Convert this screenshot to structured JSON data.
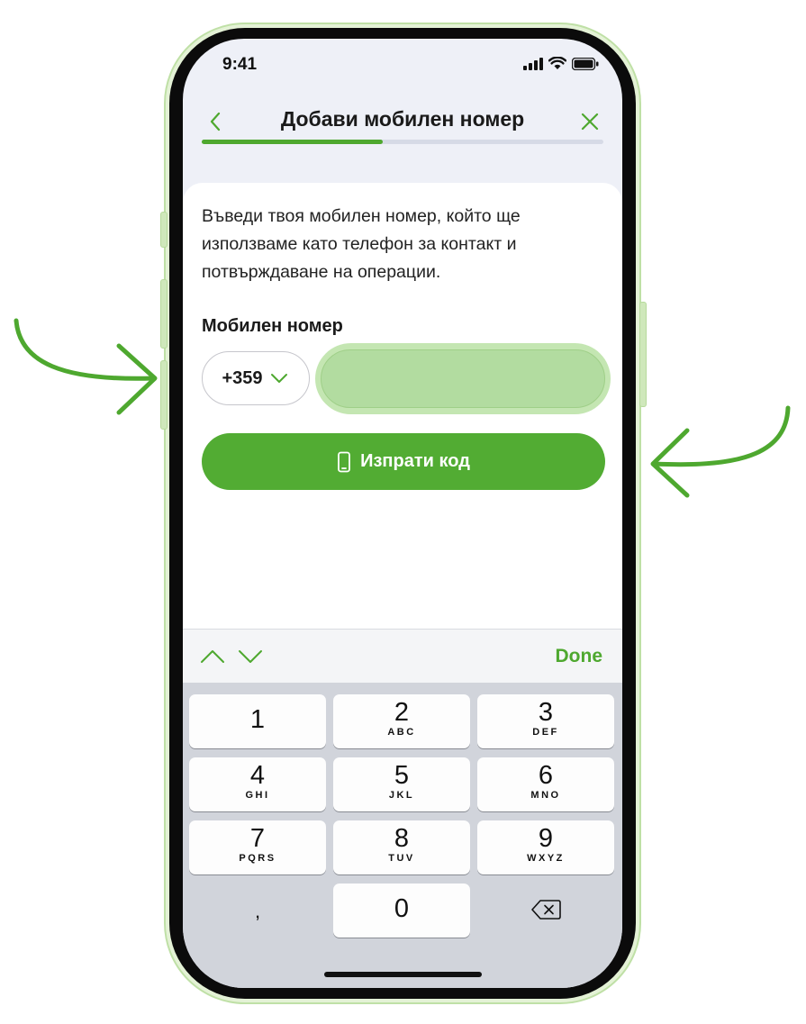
{
  "status_bar": {
    "time": "9:41"
  },
  "header": {
    "title": "Добави мобилен номер",
    "progress": 0.45
  },
  "content": {
    "description_lines": [
      "Въведи твоя мобилен номер, който ще",
      "използваме като телефон за контакт и",
      "потвърждаване на операции."
    ],
    "field_label": "Мобилен номер",
    "country_code": "+359",
    "phone_value": "",
    "send_button_label": "Изпрати код"
  },
  "keyboard": {
    "done_label": "Done",
    "keys": [
      {
        "digit": "1",
        "letters": ""
      },
      {
        "digit": "2",
        "letters": "ABC"
      },
      {
        "digit": "3",
        "letters": "DEF"
      },
      {
        "digit": "4",
        "letters": "GHI"
      },
      {
        "digit": "5",
        "letters": "JKL"
      },
      {
        "digit": "6",
        "letters": "MNO"
      },
      {
        "digit": "7",
        "letters": "PQRS"
      },
      {
        "digit": "8",
        "letters": "TUV"
      },
      {
        "digit": "9",
        "letters": "WXYZ"
      },
      {
        "digit": "0",
        "letters": ""
      }
    ],
    "comma_key": ","
  },
  "colors": {
    "accent": "#4ea82f",
    "input_highlight": "#b2dca0",
    "phone_frame": "#bfe0a6",
    "annotation_arrows": "#4ea82f"
  }
}
